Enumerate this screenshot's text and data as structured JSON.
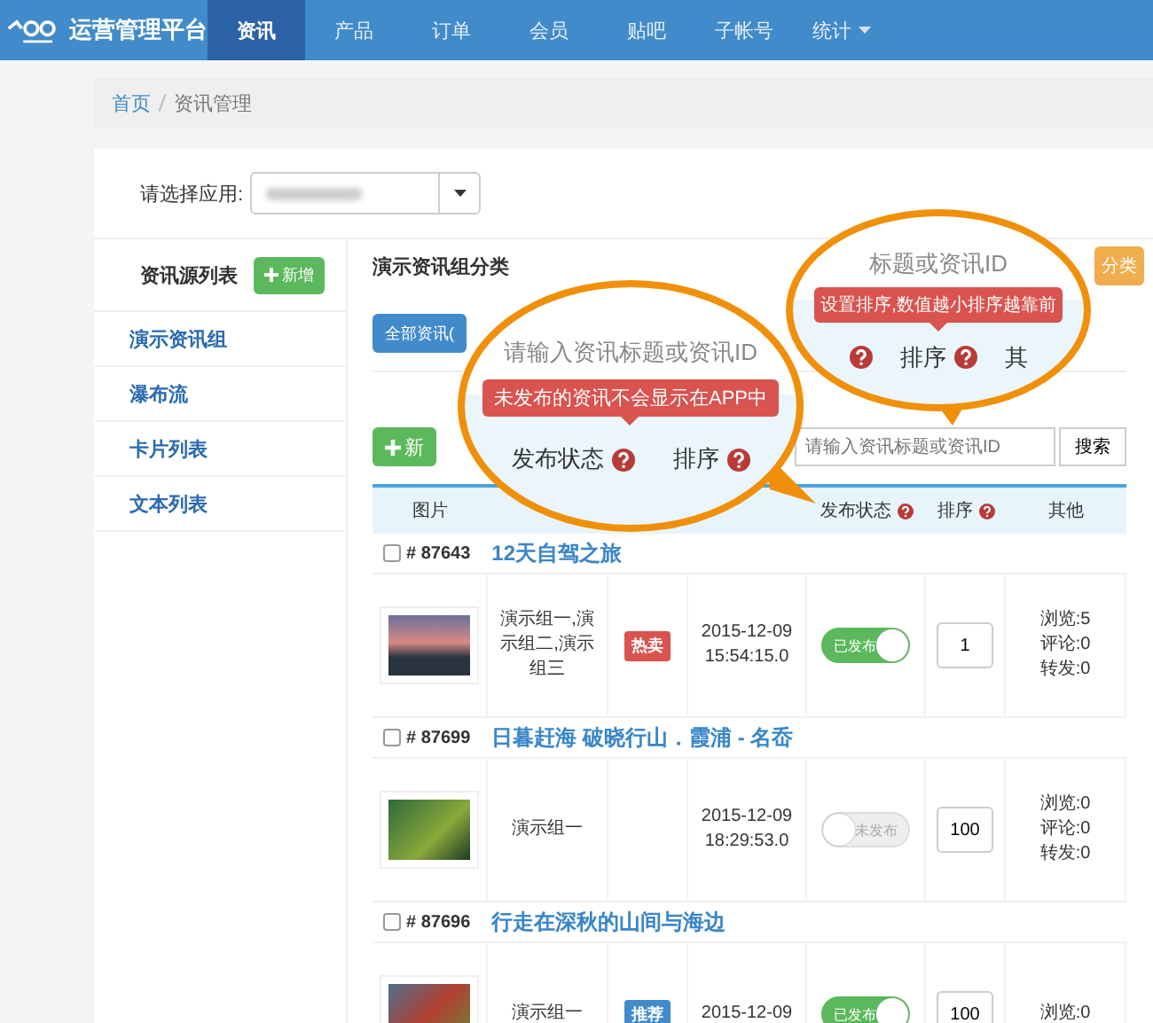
{
  "nav": {
    "brand": "运营管理平台",
    "items": [
      {
        "label": "资讯",
        "selected": true,
        "dropdown": false
      },
      {
        "label": "产品",
        "selected": false,
        "dropdown": false
      },
      {
        "label": "订单",
        "selected": false,
        "dropdown": false
      },
      {
        "label": "会员",
        "selected": false,
        "dropdown": false
      },
      {
        "label": "贴吧",
        "selected": false,
        "dropdown": false
      },
      {
        "label": "子帐号",
        "selected": false,
        "dropdown": false
      },
      {
        "label": "统计",
        "selected": false,
        "dropdown": true
      }
    ]
  },
  "breadcrumb": [
    "首页",
    "资讯管理"
  ],
  "app_select": {
    "label": "请选择应用:"
  },
  "sidebar": {
    "title": "资讯源列表",
    "add_button": "新增",
    "items": [
      "演示资讯组",
      "瀑布流",
      "卡片列表",
      "文本列表"
    ]
  },
  "main": {
    "title": "演示资讯组分类",
    "category_button": "分类",
    "tabs": [
      {
        "label": "全部资讯(",
        "selected": true
      }
    ],
    "add_button": "新",
    "search": {
      "placeholder": "请输入资讯标题或资讯ID",
      "button": "搜索"
    }
  },
  "table": {
    "columns": [
      {
        "kind": "image",
        "label": "图片",
        "help": false
      },
      {
        "kind": "status",
        "label": "发布状态",
        "help": true
      },
      {
        "kind": "sort",
        "label": "排序",
        "help": true
      },
      {
        "kind": "other",
        "label": "其他",
        "help": false
      }
    ],
    "rows": [
      {
        "id": "# 87643",
        "checked": false,
        "title": "12天自驾之旅",
        "groups": "演示组一,演示组二,演示组三",
        "tag": {
          "label": "热卖",
          "color": "#d9534f"
        },
        "date": "2015-12-09 15:54:15.0",
        "published": true,
        "status_label": "已发布",
        "sort": "1",
        "stats": [
          "浏览:5",
          "评论:0",
          "转发:0"
        ]
      },
      {
        "id": "# 87699",
        "checked": false,
        "title": "日暮赶海 破晓行山．霞浦 - 名岙",
        "groups": "演示组一",
        "date": "2015-12-09 18:29:53.0",
        "published": false,
        "status_label": "未发布",
        "sort": "100",
        "stats": [
          "浏览:0",
          "评论:0",
          "转发:0"
        ]
      },
      {
        "id": "# 87696",
        "checked": false,
        "title": "行走在深秋的山间与海边",
        "groups": "演示组一",
        "tag": {
          "label": "推荐",
          "color": "#428bca"
        },
        "date": "2015-12-09",
        "published": true,
        "status_label": "已发布",
        "sort": "100",
        "stats": [
          "浏览:0"
        ]
      }
    ]
  },
  "callouts": [
    {
      "field_text": "请输入资讯标题或资讯ID",
      "tooltip": "未发布的资讯不会显示在APP中",
      "columns": [
        {
          "label": "发布状态",
          "help": true
        },
        {
          "label": "排序",
          "help": true
        }
      ]
    },
    {
      "field_text": "标题或资讯ID",
      "tooltip": "设置排序,数值越小排序越靠前",
      "columns": [
        {
          "help": true
        },
        {
          "label": "排序",
          "help": true
        },
        {
          "label": "其",
          "help": false
        }
      ]
    }
  ]
}
